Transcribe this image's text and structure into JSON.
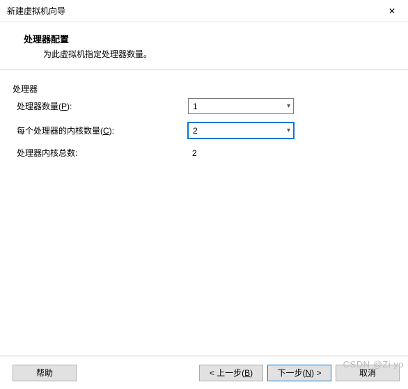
{
  "titlebar": {
    "title": "新建虚拟机向导",
    "close_icon": "✕"
  },
  "header": {
    "title": "处理器配置",
    "subtitle": "为此虚拟机指定处理器数量。"
  },
  "group": {
    "label": "处理器"
  },
  "fields": {
    "proc_count": {
      "label_pre": "处理器数量(",
      "hotkey": "P",
      "label_post": "):",
      "value": "1"
    },
    "cores_per": {
      "label_pre": "每个处理器的内核数量(",
      "hotkey": "C",
      "label_post": "):",
      "value": "2"
    },
    "total": {
      "label": "处理器内核总数:",
      "value": "2"
    }
  },
  "buttons": {
    "help": "帮助",
    "back_pre": "< 上一步(",
    "back_hot": "B",
    "back_post": ")",
    "next_pre": "下一步(",
    "next_hot": "N",
    "next_post": ") >",
    "cancel": "取消"
  },
  "watermark": "CSDN @Zi yo"
}
